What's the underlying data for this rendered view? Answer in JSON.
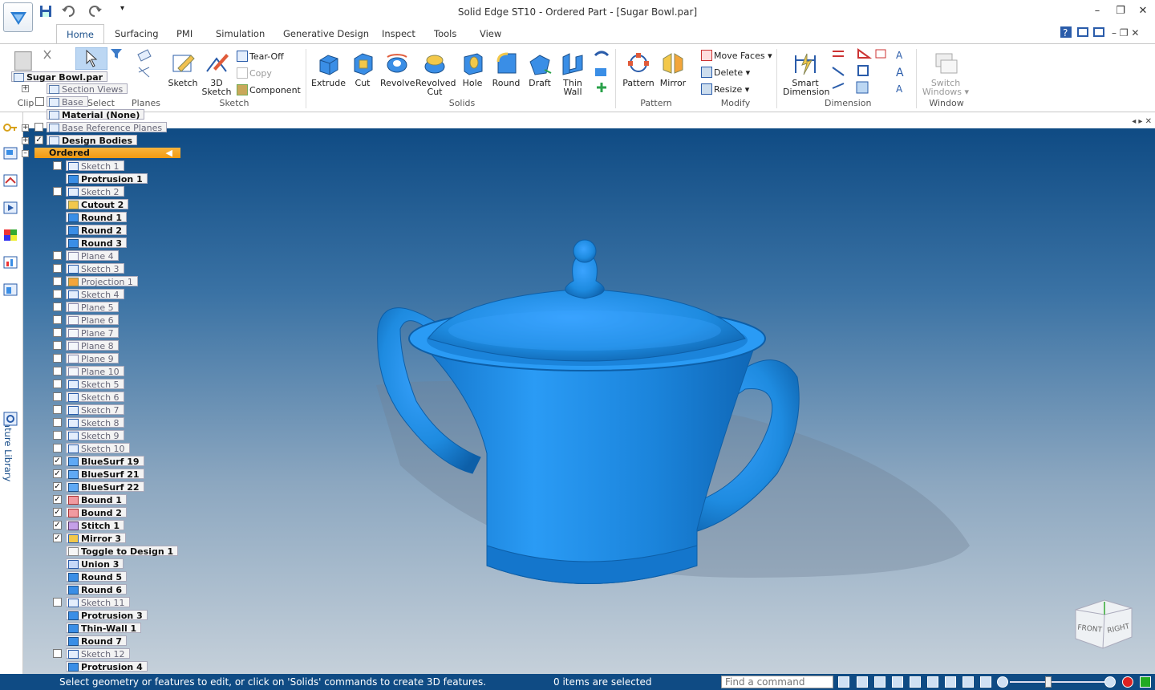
{
  "window": {
    "title": "Solid Edge ST10 - Ordered Part - [Sugar Bowl.par]"
  },
  "ribbon": {
    "tabs": [
      "Home",
      "Surfacing",
      "PMI",
      "Simulation",
      "Generative Design",
      "Inspect",
      "Tools",
      "View"
    ],
    "groups": {
      "clipboard_label": "Clip",
      "select_label": "Select",
      "planes_label": "Planes",
      "sketch_group_label": "Sketch",
      "solids_label": "Solids",
      "pattern_group_label": "Pattern",
      "modify_label": "Modify",
      "dimension_label": "Dimension",
      "window_label": "Window"
    },
    "buttons": {
      "sketch": "Sketch",
      "sketch3d_line1": "3D",
      "sketch3d_line2": "Sketch",
      "tear_off": "Tear-Off",
      "copy": "Copy",
      "component": "Component",
      "extrude": "Extrude",
      "cut": "Cut",
      "revolve": "Revolve",
      "revolved_cut_line1": "Revolved",
      "revolved_cut_line2": "Cut",
      "hole": "Hole",
      "round": "Round",
      "draft": "Draft",
      "thin_wall_line1": "Thin",
      "thin_wall_line2": "Wall",
      "pattern": "Pattern",
      "mirror": "Mirror",
      "move_faces": "Move Faces",
      "delete": "Delete",
      "resize": "Resize",
      "smart_dim_line1": "Smart",
      "smart_dim_line2": "Dimension",
      "switch_windows_line1": "Switch",
      "switch_windows_line2": "Windows"
    }
  },
  "pathfinder": {
    "document": "Sugar Bowl.par",
    "section_views": "Section Views",
    "base": "Base",
    "material": "Material (None)",
    "base_reference_planes": "Base Reference Planes",
    "design_bodies": "Design Bodies",
    "ordered": "Ordered",
    "features": [
      {
        "label": "Sketch 1",
        "check": "empty",
        "kind": "sketch",
        "dim": true
      },
      {
        "label": "Protrusion 1",
        "check": "none",
        "kind": "protrusion",
        "dim": false
      },
      {
        "label": "Sketch 2",
        "check": "empty",
        "kind": "sketch",
        "dim": true
      },
      {
        "label": "Cutout 2",
        "check": "none",
        "kind": "cutout",
        "dim": false
      },
      {
        "label": "Round 1",
        "check": "none",
        "kind": "round",
        "dim": false
      },
      {
        "label": "Round 2",
        "check": "none",
        "kind": "round",
        "dim": false
      },
      {
        "label": "Round 3",
        "check": "none",
        "kind": "round",
        "dim": false
      },
      {
        "label": "Plane 4",
        "check": "empty",
        "kind": "plane",
        "dim": true
      },
      {
        "label": "Sketch 3",
        "check": "empty",
        "kind": "sketch",
        "dim": true
      },
      {
        "label": "Projection 1",
        "check": "empty",
        "kind": "projection",
        "dim": true
      },
      {
        "label": "Sketch 4",
        "check": "empty",
        "kind": "sketch",
        "dim": true
      },
      {
        "label": "Plane 5",
        "check": "empty",
        "kind": "plane",
        "dim": true
      },
      {
        "label": "Plane 6",
        "check": "empty",
        "kind": "plane",
        "dim": true
      },
      {
        "label": "Plane 7",
        "check": "empty",
        "kind": "plane",
        "dim": true
      },
      {
        "label": "Plane 8",
        "check": "empty",
        "kind": "plane",
        "dim": true
      },
      {
        "label": "Plane 9",
        "check": "empty",
        "kind": "plane",
        "dim": true
      },
      {
        "label": "Plane 10",
        "check": "empty",
        "kind": "plane",
        "dim": true
      },
      {
        "label": "Sketch 5",
        "check": "empty",
        "kind": "sketch",
        "dim": true
      },
      {
        "label": "Sketch 6",
        "check": "empty",
        "kind": "sketch",
        "dim": true
      },
      {
        "label": "Sketch 7",
        "check": "empty",
        "kind": "sketch",
        "dim": true
      },
      {
        "label": "Sketch 8",
        "check": "empty",
        "kind": "sketch",
        "dim": true
      },
      {
        "label": "Sketch 9",
        "check": "empty",
        "kind": "sketch",
        "dim": true
      },
      {
        "label": "Sketch 10",
        "check": "empty",
        "kind": "sketch",
        "dim": true
      },
      {
        "label": "BlueSurf 19",
        "check": "checked",
        "kind": "bluesurf",
        "dim": false
      },
      {
        "label": "BlueSurf 21",
        "check": "checked",
        "kind": "bluesurf",
        "dim": false
      },
      {
        "label": "BlueSurf 22",
        "check": "checked",
        "kind": "bluesurf",
        "dim": false
      },
      {
        "label": "Bound 1",
        "check": "checked",
        "kind": "bound",
        "dim": false
      },
      {
        "label": "Bound 2",
        "check": "checked",
        "kind": "bound",
        "dim": false
      },
      {
        "label": "Stitch 1",
        "check": "checked",
        "kind": "stitch",
        "dim": false
      },
      {
        "label": "Mirror 3",
        "check": "checked",
        "kind": "mirror",
        "dim": false
      },
      {
        "label": "Toggle to Design 1",
        "check": "none",
        "kind": "toggle",
        "dim": false
      },
      {
        "label": "Union 3",
        "check": "none",
        "kind": "union",
        "dim": false
      },
      {
        "label": "Round 5",
        "check": "none",
        "kind": "round",
        "dim": false
      },
      {
        "label": "Round 6",
        "check": "none",
        "kind": "round",
        "dim": false
      },
      {
        "label": "Sketch 11",
        "check": "empty",
        "kind": "sketch",
        "dim": true
      },
      {
        "label": "Protrusion 3",
        "check": "none",
        "kind": "protrusion",
        "dim": false
      },
      {
        "label": "Thin-Wall 1",
        "check": "none",
        "kind": "thinwall",
        "dim": false
      },
      {
        "label": "Round 7",
        "check": "none",
        "kind": "round",
        "dim": false
      },
      {
        "label": "Sketch 12",
        "check": "empty",
        "kind": "sketch",
        "dim": true
      },
      {
        "label": "Protrusion 4",
        "check": "none",
        "kind": "protrusion",
        "dim": false
      }
    ]
  },
  "left_toolbar": {
    "feature_library": "Feature Library"
  },
  "viewport": {
    "model_color": "#1e8be0",
    "viewcube": {
      "front": "FRONT",
      "right": "RIGHT"
    }
  },
  "statusbar": {
    "message": "Select geometry or features to edit, or click on 'Solids' commands to create 3D features.",
    "selection": "0 items are selected",
    "find_placeholder": "Find a command"
  }
}
